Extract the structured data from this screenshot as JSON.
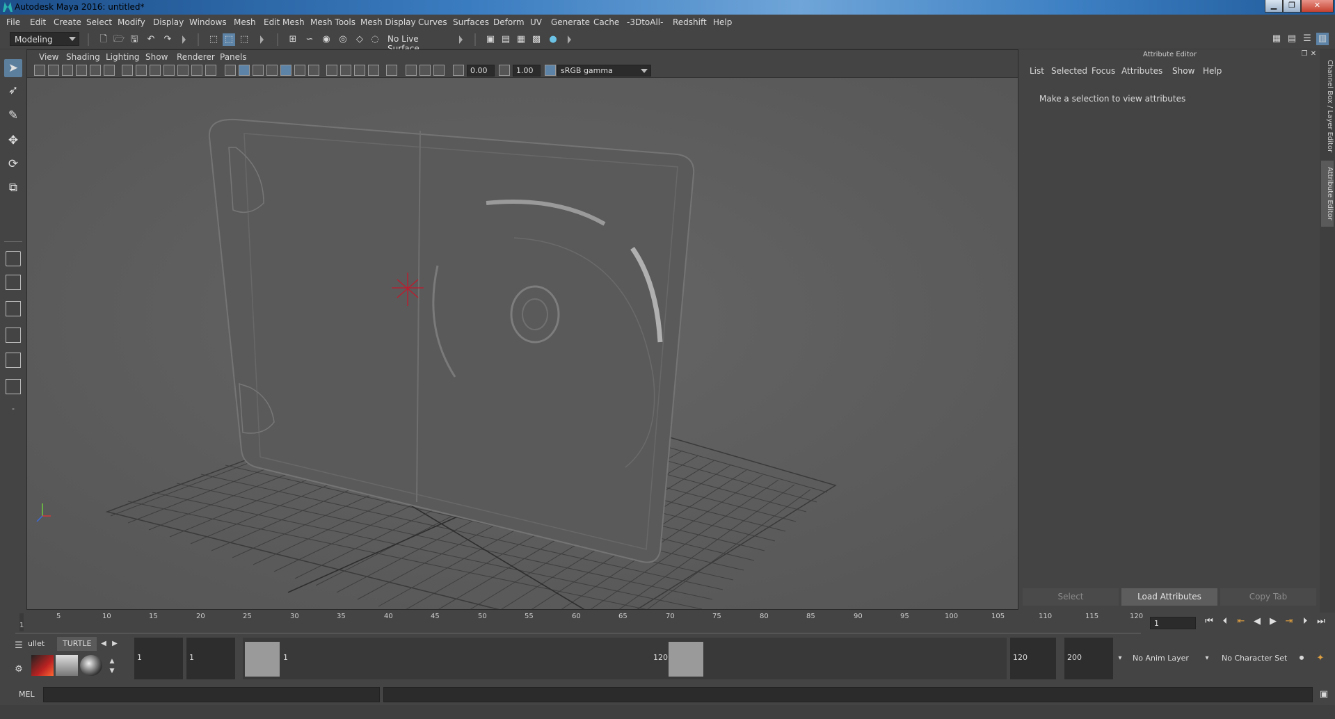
{
  "window": {
    "title": "Autodesk Maya 2016: untitled*",
    "minimize": "▁",
    "restore": "❐",
    "close": "✕"
  },
  "menubar": [
    "File",
    "Edit",
    "Create",
    "Select",
    "Modify",
    "Display",
    "Windows",
    "Mesh",
    "Edit Mesh",
    "Mesh Tools",
    "Mesh Display",
    "Curves",
    "Surfaces",
    "Deform",
    "UV",
    "Generate",
    "Cache",
    "-3DtoAll-",
    "Redshift",
    "Help"
  ],
  "statusline": {
    "mode": "Modeling",
    "live_surface": "No Live Surface"
  },
  "panel": {
    "menu": [
      "View",
      "Shading",
      "Lighting",
      "Show",
      "Renderer",
      "Panels"
    ],
    "exposure": "0.00",
    "gamma": "1.00",
    "colorspace": "sRGB gamma",
    "camera": "persp"
  },
  "attribute_editor": {
    "title": "Attribute Editor",
    "menu": [
      "List",
      "Selected",
      "Focus",
      "Attributes",
      "Show",
      "Help"
    ],
    "message": "Make a selection to view attributes",
    "buttons": {
      "select": "Select",
      "load": "Load Attributes",
      "copy": "Copy Tab"
    }
  },
  "side_tabs": {
    "channel_box": "Channel Box / Layer Editor",
    "attribute_editor": "Attribute Editor"
  },
  "timeslider": {
    "ticks": [
      "1",
      "5",
      "10",
      "15",
      "20",
      "25",
      "30",
      "35",
      "40",
      "45",
      "50",
      "55",
      "60",
      "65",
      "70",
      "75",
      "80",
      "85",
      "90",
      "95",
      "100",
      "105",
      "110",
      "115",
      "120"
    ],
    "current_frame": "1"
  },
  "range": {
    "shelf_tabs": [
      "ullet",
      "TURTLE"
    ],
    "start": "1",
    "playback_start": "1",
    "slider_start": "1",
    "slider_end": "120",
    "playback_end": "120",
    "end": "200",
    "anim_layer": "No Anim Layer",
    "character_set": "No Character Set"
  },
  "cmdline": {
    "label": "MEL"
  },
  "colors": {
    "accent": "#5d83a6",
    "viewport_bg": "#5e5e5e",
    "pivot": "#c0192c"
  }
}
